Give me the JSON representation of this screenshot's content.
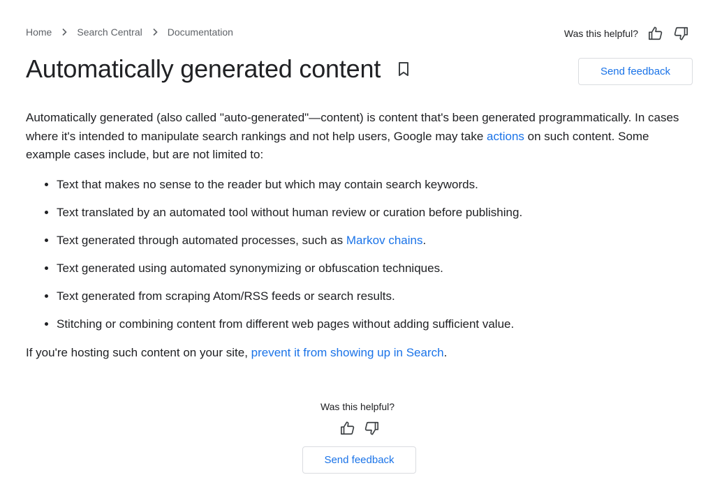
{
  "breadcrumb": {
    "items": [
      "Home",
      "Search Central",
      "Documentation"
    ]
  },
  "helpful": {
    "question": "Was this helpful?"
  },
  "page": {
    "title": "Automatically generated content"
  },
  "feedback": {
    "label": "Send feedback"
  },
  "intro": {
    "text_before": "Automatically generated (also called \"auto-generated\"—content) is content that's been generated programmatically. In cases where it's intended to manipulate search rankings and not help users, Google may take ",
    "link": "actions",
    "text_after": " on such content. Some example cases include, but are not limited to:"
  },
  "examples": {
    "item0": "Text that makes no sense to the reader but which may contain search keywords.",
    "item1": "Text translated by an automated tool without human review or curation before publishing.",
    "item2_before": "Text generated through automated processes, such as ",
    "item2_link": "Markov chains",
    "item2_after": ".",
    "item3": "Text generated using automated synonymizing or obfuscation techniques.",
    "item4": "Text generated from scraping Atom/RSS feeds or search results.",
    "item5": "Stitching or combining content from different web pages without adding sufficient value."
  },
  "footer": {
    "text_before": "If you're hosting such content on your site, ",
    "link": "prevent it from showing up in Search",
    "text_after": "."
  },
  "icons": {
    "thumb_up": "thumb-up-icon",
    "thumb_down": "thumb-down-icon",
    "bookmark": "bookmark-icon",
    "chevron": "chevron-right-icon"
  },
  "colors": {
    "link": "#1a73e8",
    "text": "#202124",
    "muted": "#5f6368",
    "border": "#dadce0"
  }
}
